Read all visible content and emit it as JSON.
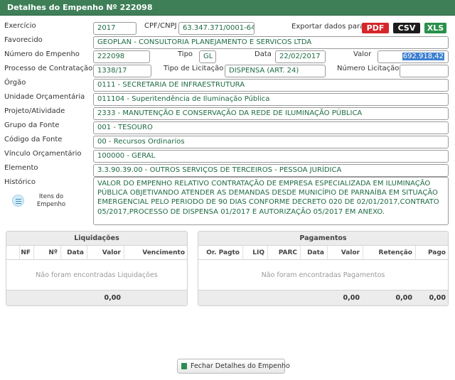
{
  "title": "Detalhes do Empenho Nº 222098",
  "labels": {
    "exercicio": "Exercício",
    "cpf_cnpj": "CPF/CNPJ",
    "exportar": "Exportar dados para:",
    "favorecido": "Favorecido",
    "numero_empenho": "Número do Empenho",
    "tipo": "Tipo",
    "data": "Data",
    "valor": "Valor",
    "processo": "Processo de Contratação",
    "tipo_licitacao": "Tipo de Licitação",
    "numero_licitacao": "Número Licitação",
    "orgao": "Órgão",
    "unidade": "Unidade Orçamentária",
    "projeto": "Projeto/Atividade",
    "grupo_fonte": "Grupo da Fonte",
    "codigo_fonte": "Código da Fonte",
    "vinculo": "Vínculo Orçamentário",
    "elemento": "Elemento",
    "historico": "Histórico"
  },
  "fields": {
    "exercicio": "2017",
    "cpf_cnpj": "63.347.371/0001-64",
    "favorecido": "GEOPLAN - CONSULTORIA PLANEJAMENTO E SERVICOS LTDA",
    "numero_empenho": "222098",
    "tipo": "GL",
    "data": "22/02/2017",
    "valor": "692.918,42",
    "processo": "1338/17",
    "tipo_licitacao": "DISPENSA (ART. 24)",
    "numero_licitacao": "",
    "orgao": "0111 - SECRETARIA DE INFRAESTRUTURA",
    "unidade": "011104 - Superitendência de Iluminação Pública",
    "projeto": "2333 - MANUTENÇÃO E CONSERVAÇÃO DA REDE DE ILUMINAÇÃO PÚBLICA",
    "grupo_fonte": "001 - TESOURO",
    "codigo_fonte": "00 - Recursos Ordinarios",
    "vinculo": "100000 - GERAL",
    "elemento": "3.3.90.39.00 - OUTROS SERVIÇOS DE TERCEIROS - PESSOA JURÍDICA",
    "historico": "VALOR DO EMPENHO RELATIVO CONTRATAÇÃO DE EMPRESA ESPECIALIZADA EM ILUMINAÇÃO PÚBLICA OBJETIVANDO ATENDER AS DEMANDAS DESDE MUNICÍPIO DE PARNAÍBA EM SITUAÇÃO EMERGENCIAL PELO PERIODO DE 90 DIAS CONFORME DECRETO 020 DE 02/01/2017,CONTRATO 05/2017,PROCESSO DE DISPENSA 01/2017 E AUTORIZAÇÃO 05/2017 EM ANEXO."
  },
  "export": {
    "pdf": "PDF",
    "csv": "CSV",
    "xls": "XLS"
  },
  "itens": {
    "line1": "Itens do",
    "line2": "Empenho"
  },
  "liquidacoes": {
    "title": "Liquidações",
    "columns": [
      "NF",
      "Nº",
      "Data",
      "Valor",
      "Vencimento"
    ],
    "empty": "Não foram encontradas Liquidações",
    "total": "0,00"
  },
  "pagamentos": {
    "title": "Pagamentos",
    "columns": [
      "Or. Pagto",
      "LIQ",
      "PARC",
      "Data",
      "Valor",
      "Retenção",
      "Pago"
    ],
    "empty": "Não foram encontradas Pagamentos",
    "totals": [
      "0,00",
      "0,00",
      "0,00"
    ]
  },
  "close_button": "Fechar Detalhes do Empenho",
  "colors": {
    "header": "#3e7f58",
    "field_text": "#1d6b43",
    "pdf": "#d6262a",
    "csv": "#1c1c1c",
    "xls": "#27914a"
  }
}
